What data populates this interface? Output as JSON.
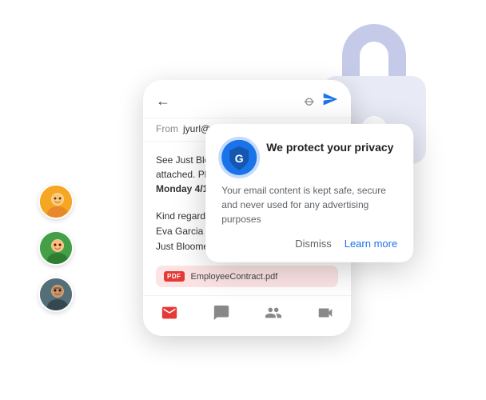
{
  "header": {
    "from_label": "From",
    "from_email": "jyurl@mo.co",
    "back_icon": "←",
    "attachment_icon": "📎",
    "send_icon": "➤"
  },
  "email": {
    "body": "See Just Bloomed employee contract attached. Please flag any legal issues by ",
    "bold_date": "Monday 4/10.",
    "greeting": "Kind regards,",
    "signature_name": "Eva Garcia",
    "signature_company": "Just Bloomed | Owner & Founder"
  },
  "attachment": {
    "badge": "PDF",
    "filename": "EmployeeContract.pdf"
  },
  "privacy_popup": {
    "title": "We protect your privacy",
    "description": "Your email content is kept safe, secure and never used for any advertising purposes",
    "dismiss_label": "Dismiss",
    "learn_more_label": "Learn more"
  },
  "avatars": [
    {
      "bg": "#f4a435",
      "emoji": "👦"
    },
    {
      "bg": "#4caf50",
      "emoji": "👩"
    },
    {
      "bg": "#607d8b",
      "emoji": "👨"
    }
  ],
  "bottom_nav": [
    {
      "icon": "✉",
      "color": "#e53935"
    },
    {
      "icon": "💬",
      "color": "#888"
    },
    {
      "icon": "👥",
      "color": "#888"
    },
    {
      "icon": "▶",
      "color": "#888"
    }
  ],
  "lock": {
    "body_color": "#e8eaf6",
    "shackle_color": "#c5cae9"
  }
}
